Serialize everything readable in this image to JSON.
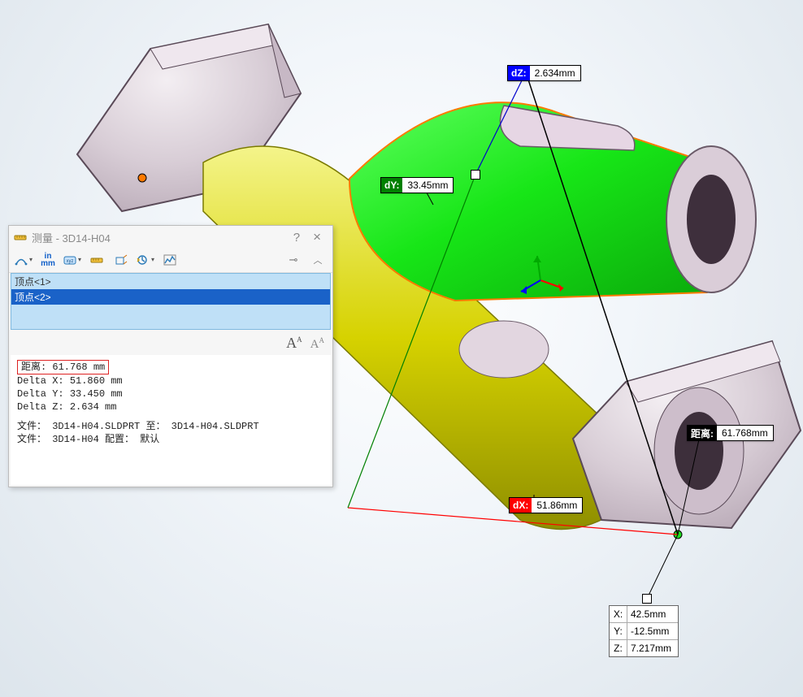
{
  "dialog": {
    "title": "测量 - 3D14-H04",
    "selection": [
      "顶点<1>",
      "顶点<2>"
    ],
    "results": {
      "distance_label": "距离:",
      "distance_value": "61.768 mm",
      "dx_label": "Delta X:",
      "dx_value": "51.860 mm",
      "dy_label": "Delta Y:",
      "dy_value": "33.450 mm",
      "dz_label": "Delta Z:",
      "dz_value": "2.634 mm",
      "file1_label": "文件：",
      "file1_value": "3D14-H04.SLDPRT 至： 3D14-H04.SLDPRT",
      "file2_label": "文件：",
      "file2_value": "3D14-H04 配置： 默认"
    }
  },
  "callouts": {
    "dz": {
      "tag": "dZ:",
      "value": "2.634mm"
    },
    "dy": {
      "tag": "dY:",
      "value": "33.45mm"
    },
    "dx": {
      "tag": "dX:",
      "value": "51.86mm"
    },
    "dist": {
      "tag": "距离:",
      "value": "61.768mm"
    }
  },
  "coord": {
    "x_label": "X:",
    "x_value": "42.5mm",
    "y_label": "Y:",
    "y_value": "-12.5mm",
    "z_label": "Z:",
    "z_value": "7.217mm"
  }
}
